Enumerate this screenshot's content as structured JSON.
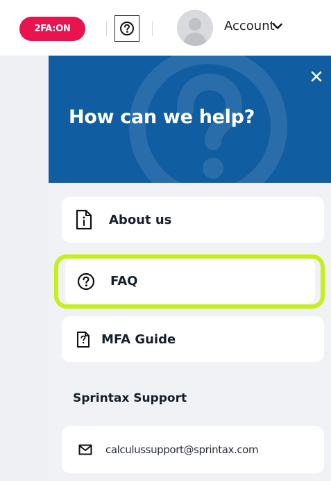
{
  "header": {
    "twofa_badge": "2FA:ON",
    "account_label": "Account"
  },
  "panel": {
    "title": "How can we help?",
    "links": [
      {
        "label": "About us",
        "icon": "info-document-icon"
      },
      {
        "label": "FAQ",
        "icon": "question-circle-icon"
      },
      {
        "label": "MFA Guide",
        "icon": "question-document-icon"
      }
    ],
    "support": {
      "title": "Sprintax Support",
      "email": "calculussupport@sprintax.com"
    }
  },
  "colors": {
    "badge": "#e8134f",
    "hero": "#115da2",
    "highlight": "#c5f01a"
  }
}
